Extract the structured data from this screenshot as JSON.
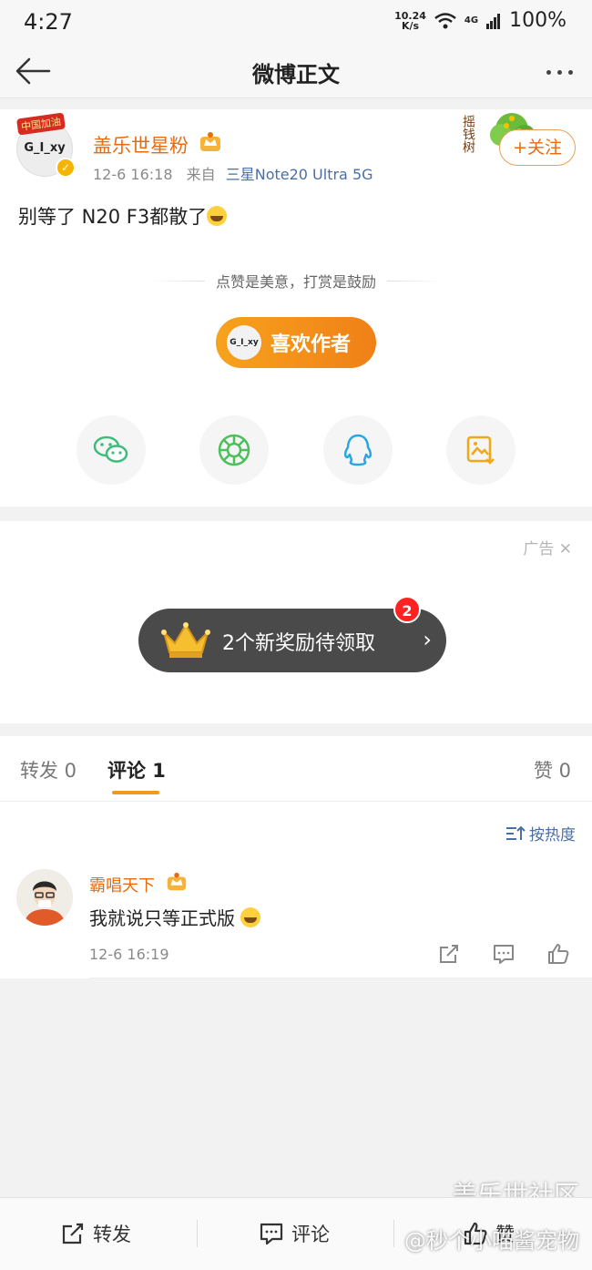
{
  "status_bar": {
    "time": "4:27",
    "net_speed": "10.24",
    "net_unit": "K/s",
    "signal": "4G",
    "battery": "100%"
  },
  "nav": {
    "title": "微博正文",
    "back_icon": "back-arrow-icon",
    "more_icon": "more-dots-icon"
  },
  "post": {
    "author_avatar_text": "G_I_xy",
    "avatar_flag_text": "中国加油",
    "author_name": "盖乐世星粉",
    "time": "12-6 16:18",
    "source_prefix": "来自",
    "source": "三星Note20 Ultra 5G",
    "tree_text": "摇钱树",
    "follow_label": "+关注",
    "text": "别等了 N20 F3都散了",
    "reward_hint": "点赞是美意，打赏是鼓励",
    "like_author_label": "喜欢作者",
    "like_author_avatar": "G_I_xy"
  },
  "share_icons": [
    "wechat-icon",
    "moments-icon",
    "qq-icon",
    "save-image-icon"
  ],
  "ad": {
    "label": "广告",
    "reward_text": "2个新奖励待领取",
    "badge_count": "2"
  },
  "tabs": {
    "repost": "转发 0",
    "comment": "评论 1",
    "like": "赞 0"
  },
  "sort_label": "按热度",
  "comment": {
    "name": "霸唱天下",
    "text": "我就说只等正式版",
    "time": "12-6 16:19"
  },
  "bottom_bar": {
    "repost": "转发",
    "comment": "评论",
    "like": "赞"
  },
  "watermark": {
    "line1": "盖乐世社区",
    "line2": "@秒个小喵酱宠物"
  },
  "colors": {
    "accent_orange": "#e86b0f",
    "link_blue": "#4a6fa5",
    "tab_underline": "#f29a1c"
  }
}
